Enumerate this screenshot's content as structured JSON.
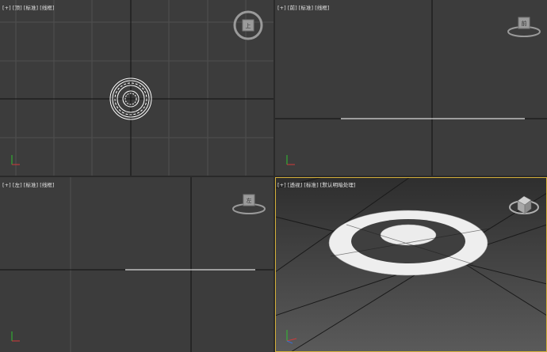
{
  "viewports": {
    "top": {
      "labels": [
        "[+]",
        "[顶]",
        "[标准]",
        "[线框]"
      ],
      "active": false
    },
    "front": {
      "labels": [
        "[+]",
        "[前]",
        "[标准]",
        "[线框]"
      ],
      "active": false
    },
    "left": {
      "labels": [
        "[+]",
        "[左]",
        "[标准]",
        "[线框]"
      ],
      "active": false
    },
    "perspective": {
      "labels": [
        "[+]",
        "[透视]",
        "[标准]",
        "[默认明暗处理]"
      ],
      "active": true
    }
  },
  "viewcube": {
    "top": "上",
    "front": "前",
    "left": "左"
  },
  "colors": {
    "viewport_bg": "#3c3c3c",
    "grid_line": "#505050",
    "axis_line": "#111111",
    "active_border": "#d4b03a",
    "object_wire": "#ffffff",
    "object_shaded": "#efefef"
  },
  "icons": [
    "viewcube-icon",
    "axis-tripod-icon"
  ]
}
